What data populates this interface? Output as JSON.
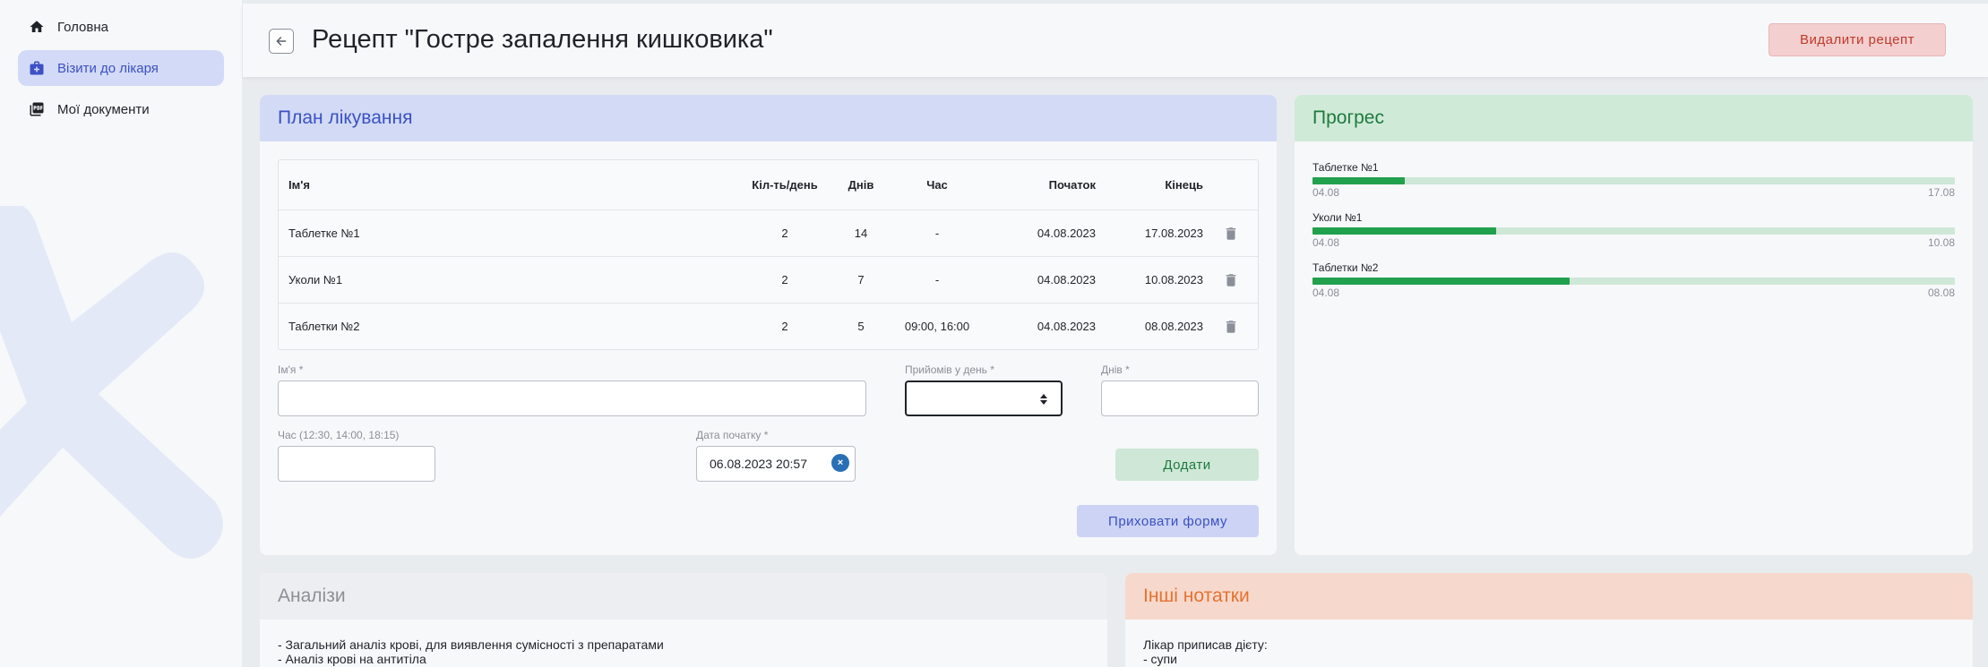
{
  "sidebar": {
    "items": [
      {
        "label": "Головна",
        "icon": "home-icon"
      },
      {
        "label": "Візити до лікаря",
        "icon": "medical-bag-icon"
      },
      {
        "label": "Мої документи",
        "icon": "pdf-documents-icon"
      }
    ]
  },
  "header": {
    "title": "Рецепт \"Гостре запалення кишковика\"",
    "delete_label": "Видалити рецепт"
  },
  "plan": {
    "title": "План лікування",
    "columns": [
      "Ім'я",
      "Кіл-ть/день",
      "Днів",
      "Час",
      "Початок",
      "Кінець"
    ],
    "rows": [
      {
        "name": "Таблетке №1",
        "qty": "2",
        "days": "14",
        "time": "-",
        "start": "04.08.2023",
        "end": "17.08.2023"
      },
      {
        "name": "Уколи №1",
        "qty": "2",
        "days": "7",
        "time": "-",
        "start": "04.08.2023",
        "end": "10.08.2023"
      },
      {
        "name": "Таблетки №2",
        "qty": "2",
        "days": "5",
        "time": "09:00, 16:00",
        "start": "04.08.2023",
        "end": "08.08.2023"
      }
    ],
    "form": {
      "name_label": "Ім'я *",
      "name_value": "",
      "per_day_label": "Прийомів у день *",
      "per_day_value": "",
      "days_label": "Днів *",
      "days_value": "",
      "time_label": "Час (12:30, 14:00, 18:15)",
      "time_value": "",
      "start_label": "Дата початку *",
      "start_value": "06.08.2023 20:57",
      "clear_symbol": "×",
      "add_label": "Додати",
      "hide_label": "Приховати форму"
    }
  },
  "progress": {
    "title": "Прогрес",
    "items": [
      {
        "name": "Таблетке №1",
        "from": "04.08",
        "to": "17.08",
        "fraction": 0.143
      },
      {
        "name": "Уколи №1",
        "from": "04.08",
        "to": "10.08",
        "fraction": 0.286
      },
      {
        "name": "Таблетки №2",
        "from": "04.08",
        "to": "08.08",
        "fraction": 0.4
      }
    ]
  },
  "analyses": {
    "title": "Аналізи",
    "line1": "- Загальний аналіз крові, для виявлення сумісності з препаратами",
    "line2": "- Аналіз крові на антитіла"
  },
  "notes": {
    "title": "Інші нотатки",
    "line1": "Лікар приписав дієту:",
    "line2": "- супи"
  },
  "colors": {
    "accent_blue": "#3b51c4",
    "progress_green": "#21a04e",
    "danger_red": "#c0392b",
    "notes_orange": "#e5722f"
  }
}
